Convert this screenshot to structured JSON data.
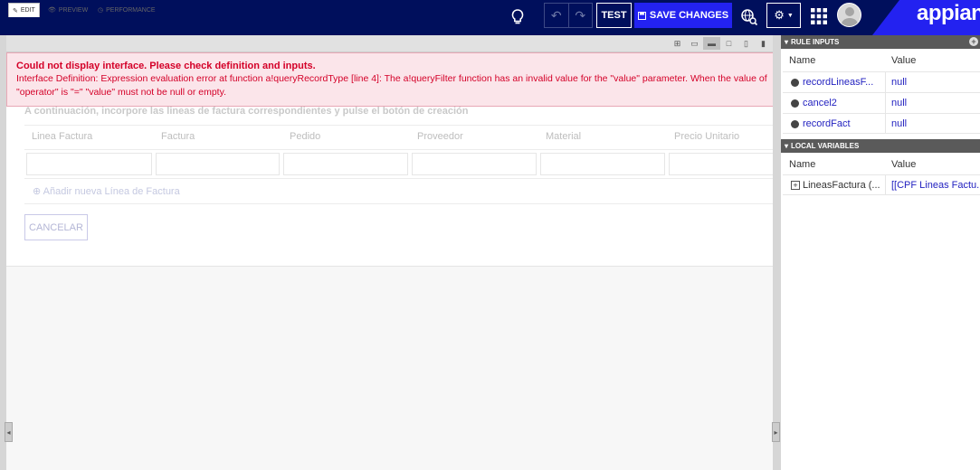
{
  "header": {
    "test_label": "TEST",
    "save_label": "SAVE CHANGES",
    "logo_text": "appian",
    "brand_color": "#000f5c",
    "accent_color": "#2322f0"
  },
  "tabs": {
    "edit": "EDIT",
    "preview": "PREVIEW",
    "performance": "PERFORMANCE"
  },
  "error": {
    "title": "Could not display interface. Please check definition and inputs.",
    "message": "Interface Definition: Expression evaluation error at function a!queryRecordType [line 4]: The a!queryFilter function has an invalid value for the \"value\" parameter. When the value of \"operator\" is \"=\" \"value\" must not be null or empty."
  },
  "form": {
    "instructions": "A continuación, incorpore las lineas de factura correspondientes y pulse el botón de creación",
    "columns": [
      "Linea Factura",
      "Factura",
      "Pedido",
      "Proveedor",
      "Material",
      "Precio Unitario"
    ],
    "add_link": "Añadir nueva Línea de Factura",
    "cancel_label": "CANCELAR"
  },
  "rule_inputs": {
    "title": "RULE INPUTS",
    "col_name": "Name",
    "col_value": "Value",
    "items": [
      {
        "name": "recordLineasF...",
        "value": "null"
      },
      {
        "name": "cancel2",
        "value": "null"
      },
      {
        "name": "recordFact",
        "value": "null"
      }
    ]
  },
  "local_variables": {
    "title": "LOCAL VARIABLES",
    "col_name": "Name",
    "col_value": "Value",
    "items": [
      {
        "name": "LineasFactura (...",
        "value": "[[CPF Lineas Factu..."
      }
    ]
  },
  "icons": {
    "bulb": "lightbulb-icon",
    "undo": "undo-icon",
    "redo": "redo-icon",
    "globe": "globe-search-icon",
    "gear": "gear-icon",
    "apps": "apps-grid-icon"
  }
}
